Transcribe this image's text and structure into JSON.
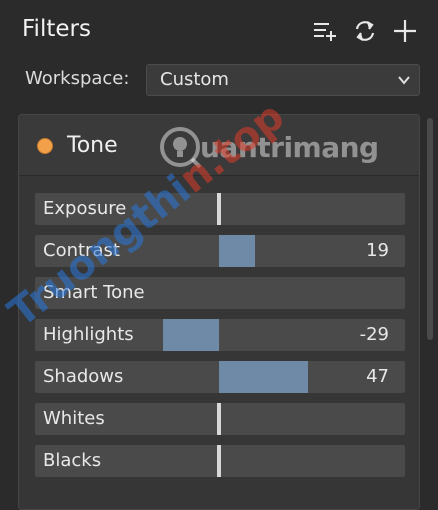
{
  "header": {
    "title": "Filters",
    "icons": [
      "add-list-icon",
      "sync-icon",
      "plus-icon"
    ]
  },
  "workspace": {
    "label": "Workspace:",
    "value": "Custom"
  },
  "panel": {
    "title": "Tone",
    "dot_color": "#f2a04a",
    "fill_color": "#6f8aa6",
    "sliders": [
      {
        "label": "Exposure",
        "value": "",
        "amount": 0
      },
      {
        "label": "Contrast",
        "value": "19",
        "amount": 19
      },
      {
        "label": "Smart Tone",
        "value": "",
        "amount": null
      },
      {
        "label": "Highlights",
        "value": "-29",
        "amount": -29
      },
      {
        "label": "Shadows",
        "value": "47",
        "amount": 47
      },
      {
        "label": "Whites",
        "value": "",
        "amount": 0
      },
      {
        "label": "Blacks",
        "value": "",
        "amount": 0
      }
    ]
  },
  "watermarks": {
    "logo_text": "uantrimang",
    "diagonal_text_a": "Truongthi",
    "diagonal_text_b": "n.top"
  }
}
